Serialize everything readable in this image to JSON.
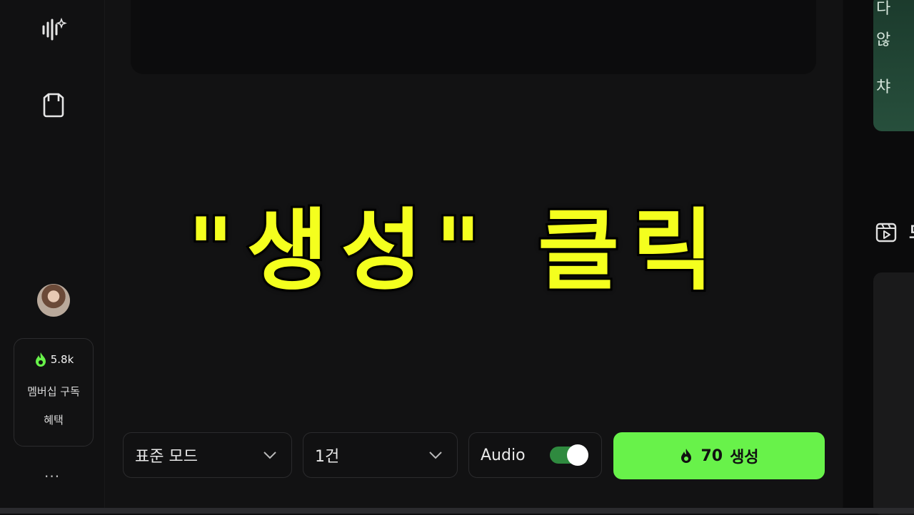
{
  "sidebar": {
    "credits": "5.8k",
    "membership_text_line1": "멤버십 구독",
    "membership_text_line2": "혜택",
    "more_label": "..."
  },
  "overlay": {
    "caption": "\"생성\" 클릭"
  },
  "controls": {
    "mode": "표준 모드",
    "count": "1건",
    "audio_label": "Audio",
    "audio_enabled": true,
    "generate_cost": "70",
    "generate_label": "생성"
  },
  "right_panel": {
    "promo_line1": "다",
    "promo_line2": "않",
    "promo_line3": "챠",
    "section_title": "모"
  },
  "colors": {
    "accent_green": "#68f24a",
    "caption_yellow": "#f4ff1e"
  }
}
